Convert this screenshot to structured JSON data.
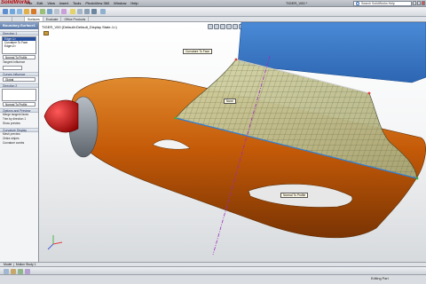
{
  "app": {
    "logo_text": "SolidWorks",
    "document_title": "TIGER_V00 *"
  },
  "menu": [
    "File",
    "Edit",
    "View",
    "Insert",
    "Tools",
    "PhotoView 360",
    "Window",
    "Help"
  ],
  "search": {
    "placeholder": "Search SolidWorks Help"
  },
  "cm_tabs": [
    "Surfaces",
    "Evaluate",
    "Office Products"
  ],
  "cm_tabs_active": "Surfaces",
  "property_manager": {
    "title": "Boundary-Surface1",
    "direction1_title": "Direction 1",
    "direction1_items": [
      "Edge<1>",
      "Curvature To Face",
      "Edge<2>"
    ],
    "direction1_selected": "Edge<1>",
    "tangent_influence": "Tangent Influence",
    "direction1_option": "Normal To Profile",
    "curves_influence_title": "Curves Influence",
    "global_label": "Global",
    "direction2_title": "Direction 2",
    "direction2_option": "Normal To Profile",
    "options_preview_title": "Options and Preview",
    "merge_faces": "Merge tangent faces",
    "trim_by_direction": "Trim by direction 1",
    "show_preview": "Show preview",
    "curvature_display_title": "Curvature Display",
    "mesh_preview": "Mesh preview",
    "zebra_stripes": "Zebra stripes",
    "curvature_combs": "Curvature combs"
  },
  "viewport": {
    "title": "TIGER_V00 (Default<Default_Display State-1>)",
    "callouts": {
      "top": "Curvature To Face",
      "mid": "None",
      "bottom": "Normal To Profile"
    }
  },
  "bottom_tabs": [
    "Model",
    "Motion Study 1"
  ],
  "status": {
    "mode": "Editing Part"
  },
  "colors": {
    "fuselage": "#c45a08",
    "wing_blue": "#3a78c8",
    "surface_mesh": "#c8c89a",
    "nose_red": "#c80000",
    "panel_header": "#5a79a8",
    "selection": "#254e9c"
  }
}
